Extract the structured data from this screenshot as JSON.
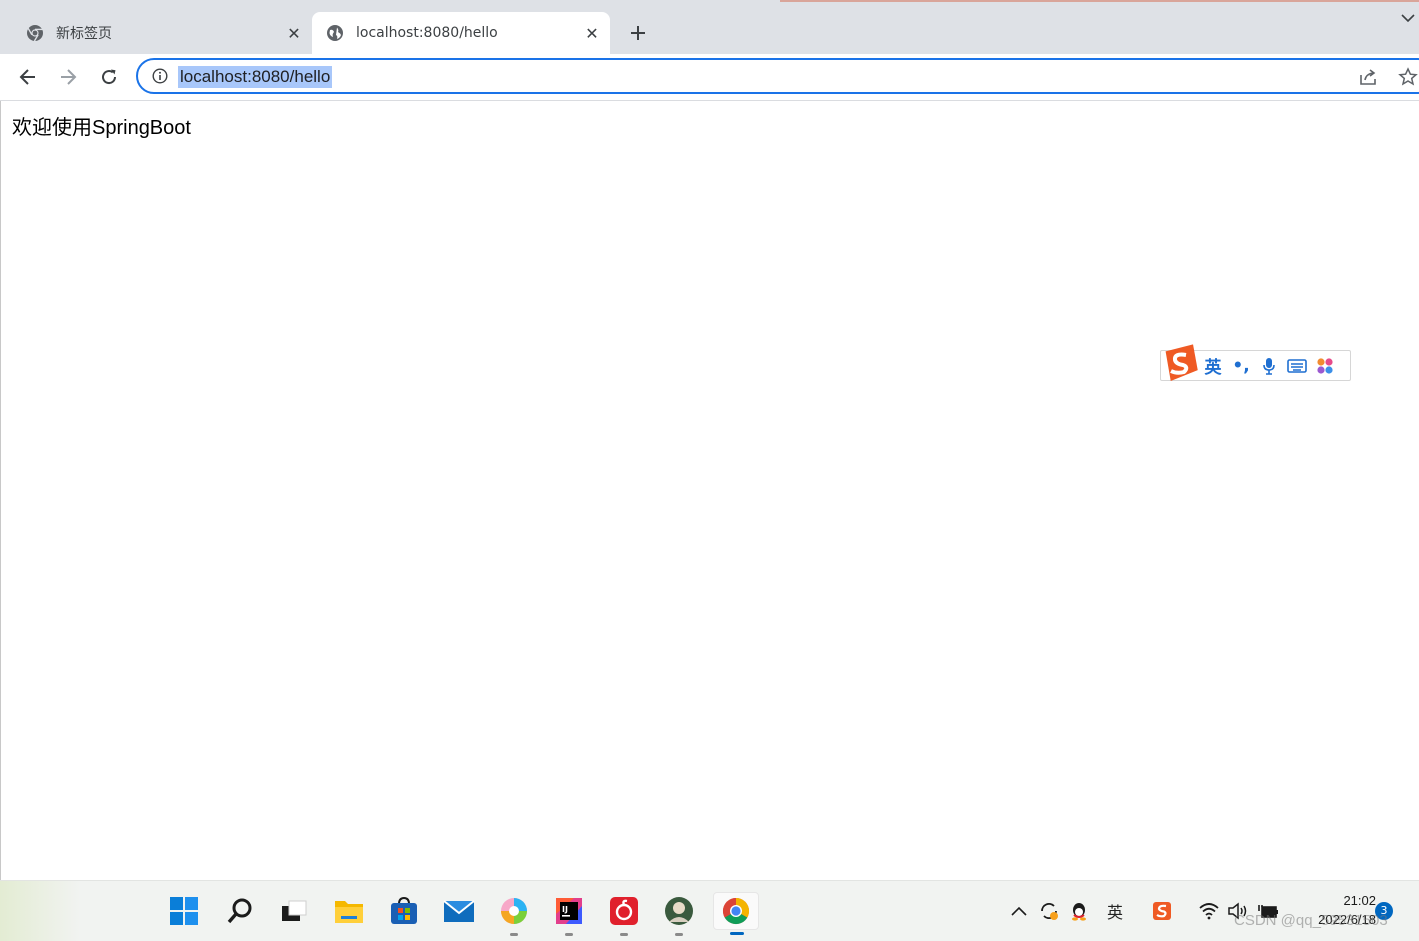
{
  "browser": {
    "tabs": [
      {
        "title": "新标签页",
        "active": false
      },
      {
        "title": "localhost:8080/hello",
        "active": true
      }
    ],
    "close_glyph": "✕",
    "address_bar": {
      "url": "localhost:8080/hello",
      "selected": true
    },
    "colors": {
      "accent": "#1a73e8",
      "selection": "#a8c7fa",
      "tabstrip": "#dee1e6"
    }
  },
  "page": {
    "welcome_text": "欢迎使用SpringBoot"
  },
  "ime": {
    "mode_label": "英",
    "punct_label": "•,",
    "icons": [
      "sogou-logo-icon",
      "microphone-icon",
      "keyboard-icon",
      "apps-icon"
    ]
  },
  "taskbar": {
    "apps": [
      "start-icon",
      "search-icon",
      "task-view-icon",
      "file-explorer-icon",
      "store-icon",
      "mail-icon",
      "photos-icon",
      "intellij-icon",
      "netease-music-icon",
      "avatar-app-icon",
      "chrome-icon"
    ],
    "tray": {
      "ime_label": "英",
      "time": "21:02",
      "date": "2022/6/18",
      "notification_count": "3"
    },
    "watermark": "CSDN @qq_59531503"
  }
}
